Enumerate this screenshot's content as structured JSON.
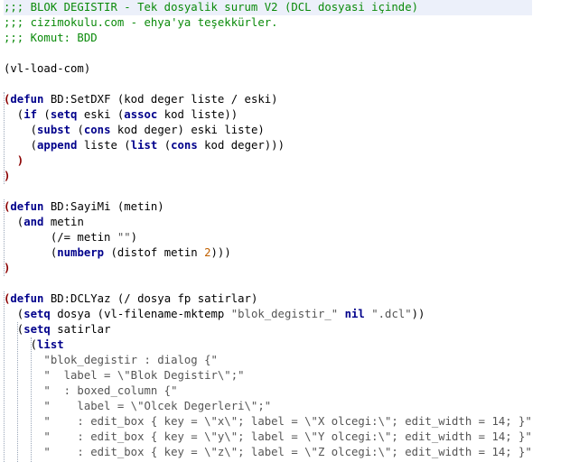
{
  "colors": {
    "comment": "#0a8a0a",
    "keyword": "#00008b",
    "paren": "#8b0000",
    "string": "#555555",
    "number": "#c06000",
    "text": "#000000",
    "current_line": "#ecf0fa"
  },
  "lines": [
    [
      [
        "c",
        ";;; BLOK DEGISTIR - Tek dosyalik surum V2 (DCL dosyasi içinde)"
      ]
    ],
    [
      [
        "c",
        ";;; cizimokulu.com - ehya'ya teşekkürler."
      ]
    ],
    [
      [
        "c",
        ";;; Komut: BDD"
      ]
    ],
    [],
    [
      [
        "x",
        "(vl-load-com)"
      ]
    ],
    [],
    [
      [
        "p",
        "("
      ],
      [
        "k",
        "defun"
      ],
      [
        "x",
        " BD:SetDXF (kod deger liste / eski)"
      ]
    ],
    [
      [
        "x",
        "  ("
      ],
      [
        "k",
        "if"
      ],
      [
        "x",
        " ("
      ],
      [
        "k",
        "setq"
      ],
      [
        "x",
        " eski ("
      ],
      [
        "k",
        "assoc"
      ],
      [
        "x",
        " kod liste))"
      ]
    ],
    [
      [
        "x",
        "    ("
      ],
      [
        "k",
        "subst"
      ],
      [
        "x",
        " ("
      ],
      [
        "k",
        "cons"
      ],
      [
        "x",
        " kod deger) eski liste)"
      ]
    ],
    [
      [
        "x",
        "    ("
      ],
      [
        "k",
        "append"
      ],
      [
        "x",
        " liste ("
      ],
      [
        "k",
        "list"
      ],
      [
        "x",
        " ("
      ],
      [
        "k",
        "cons"
      ],
      [
        "x",
        " kod deger)))"
      ]
    ],
    [
      [
        "p",
        "  )"
      ]
    ],
    [
      [
        "p",
        ")"
      ]
    ],
    [],
    [
      [
        "p",
        "("
      ],
      [
        "k",
        "defun"
      ],
      [
        "x",
        " BD:SayiMi (metin)"
      ]
    ],
    [
      [
        "x",
        "  ("
      ],
      [
        "k",
        "and"
      ],
      [
        "x",
        " metin"
      ]
    ],
    [
      [
        "x",
        "       (/= metin "
      ],
      [
        "s",
        "\"\""
      ],
      [
        "x",
        ")"
      ]
    ],
    [
      [
        "x",
        "       ("
      ],
      [
        "k",
        "numberp"
      ],
      [
        "x",
        " (distof metin "
      ],
      [
        "n",
        "2"
      ],
      [
        "x",
        ")))"
      ]
    ],
    [
      [
        "p",
        ")"
      ]
    ],
    [],
    [
      [
        "p",
        "("
      ],
      [
        "k",
        "defun"
      ],
      [
        "x",
        " BD:DCLYaz (/ dosya fp satirlar)"
      ]
    ],
    [
      [
        "x",
        "  ("
      ],
      [
        "k",
        "setq"
      ],
      [
        "x",
        " dosya (vl-filename-mktemp "
      ],
      [
        "s",
        "\"blok_degistir_\""
      ],
      [
        "x",
        " "
      ],
      [
        "k",
        "nil"
      ],
      [
        "x",
        " "
      ],
      [
        "s",
        "\".dcl\""
      ],
      [
        "x",
        "))"
      ]
    ],
    [
      [
        "x",
        "  ("
      ],
      [
        "k",
        "setq"
      ],
      [
        "x",
        " satirlar"
      ]
    ],
    [
      [
        "x",
        "    ("
      ],
      [
        "k",
        "list"
      ]
    ],
    [
      [
        "s",
        "      \"blok_degistir : dialog {\""
      ]
    ],
    [
      [
        "s",
        "      \"  label = \\\"Blok Degistir\\\";\""
      ]
    ],
    [
      [
        "s",
        "      \"  : boxed_column {\""
      ]
    ],
    [
      [
        "s",
        "      \"    label = \\\"Olcek Degerleri\\\";\""
      ]
    ],
    [
      [
        "s",
        "      \"    : edit_box { key = \\\"x\\\"; label = \\\"X olcegi:\\\"; edit_width = 14; }\""
      ]
    ],
    [
      [
        "s",
        "      \"    : edit_box { key = \\\"y\\\"; label = \\\"Y olcegi:\\\"; edit_width = 14; }\""
      ]
    ],
    [
      [
        "s",
        "      \"    : edit_box { key = \\\"z\\\"; label = \\\"Z olcegi:\\\"; edit_width = 14; }\""
      ]
    ]
  ]
}
